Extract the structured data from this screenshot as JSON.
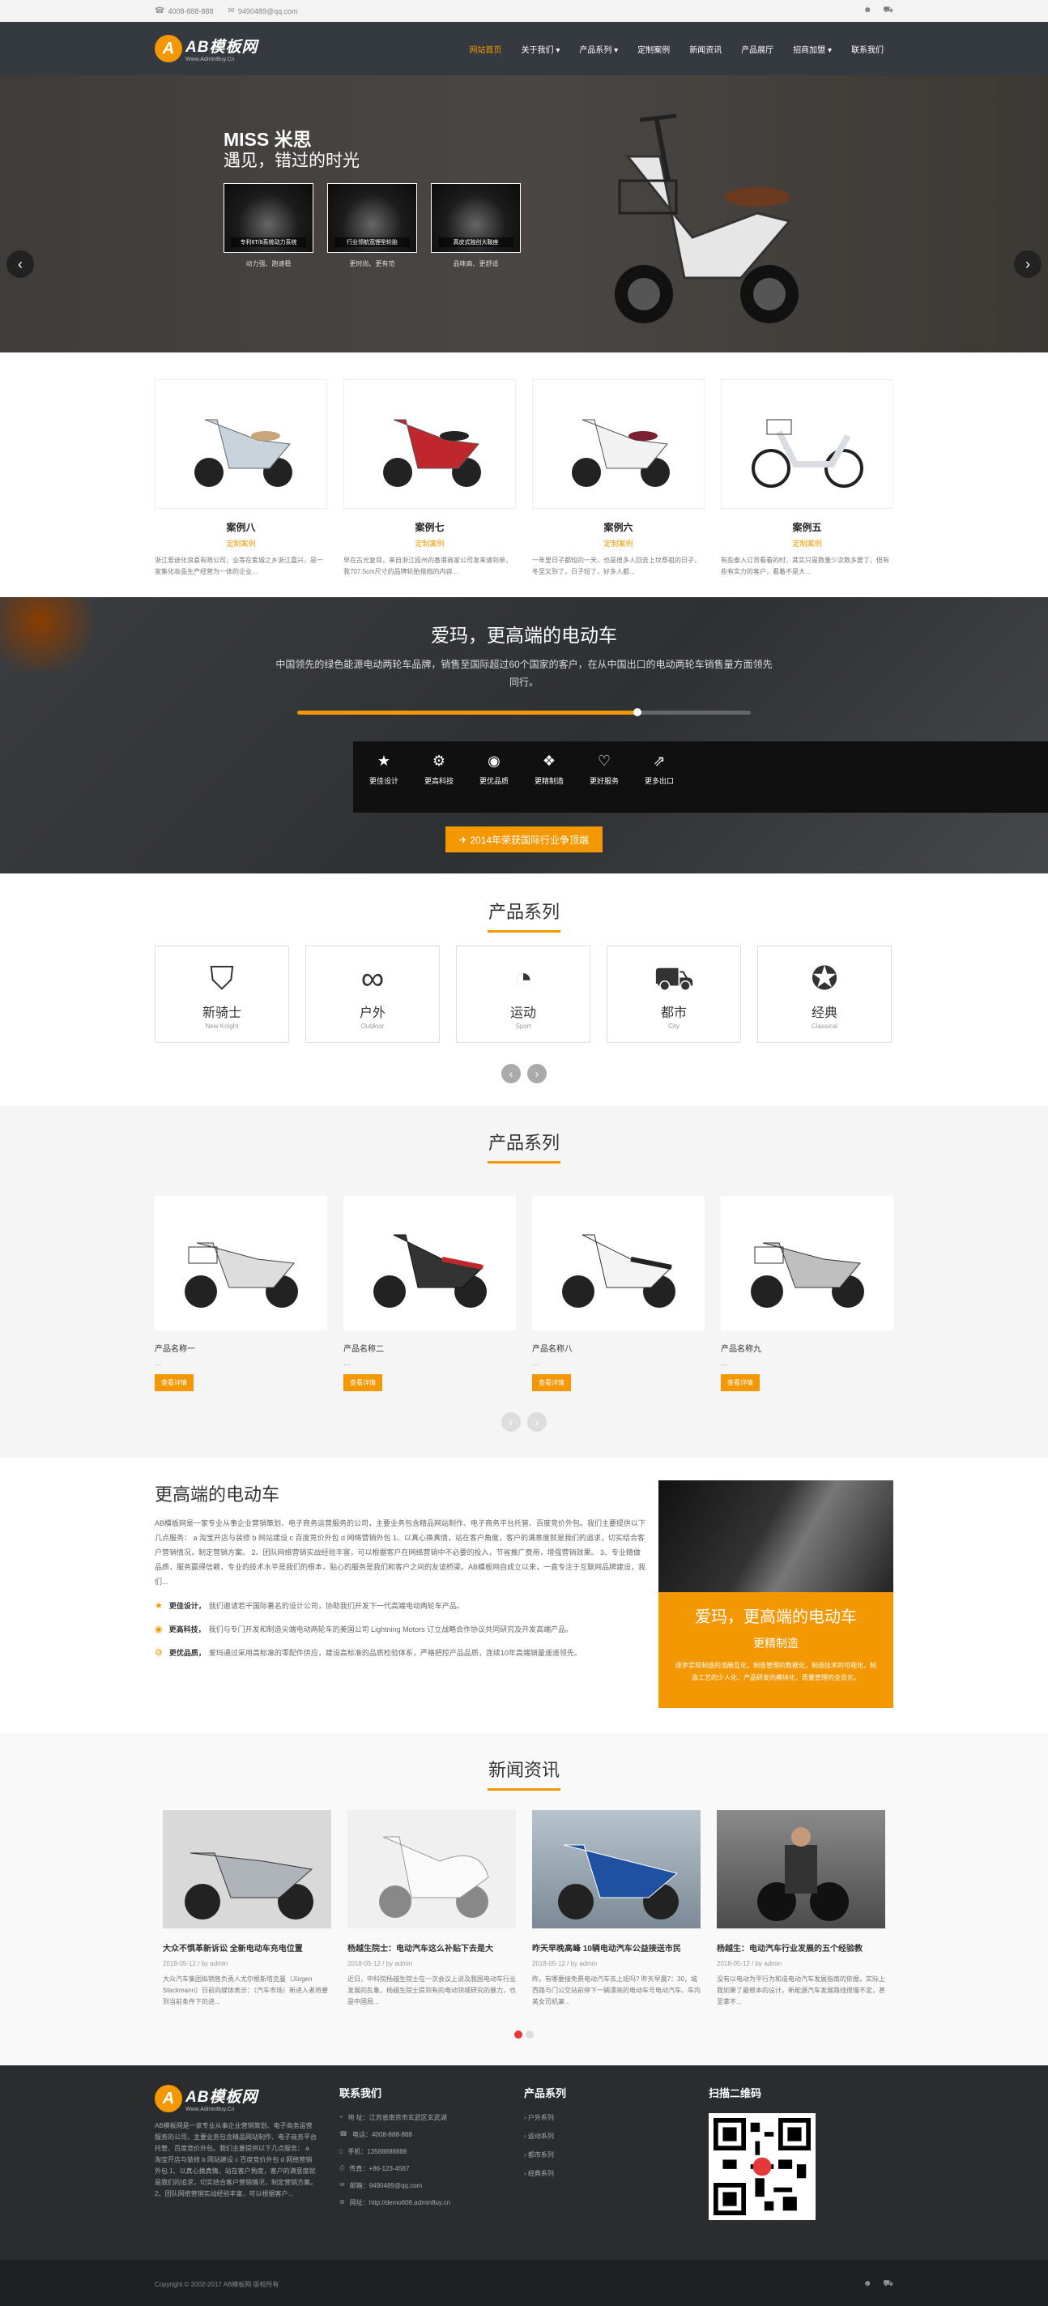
{
  "topbar": {
    "phone": "4008-888-888",
    "email": "9490489@qq.com",
    "user_icon": "user-icon",
    "cart_icon": "cart-icon"
  },
  "header": {
    "logo_name": "AB模板网",
    "logo_sub": "Www.AdminBuy.Cn",
    "nav": [
      "网站首页",
      "关于我们 ▾",
      "产品系列 ▾",
      "定制案例",
      "新闻资讯",
      "产品展厅",
      "招商加盟 ▾",
      "联系我们"
    ]
  },
  "banner": {
    "title": "MISS 米思",
    "subtitle": "遇见，错过的时光",
    "features": [
      {
        "cap": "专利6T/8系统动力系统",
        "desc": "动力强、跑速稳"
      },
      {
        "cap": "行业领航宽锂型轮胎",
        "desc": "更时尚、更有范"
      },
      {
        "cap": "真皮式独创大鞍座",
        "desc": "品味高、更舒适"
      }
    ]
  },
  "cases": [
    {
      "title": "案例八",
      "sub": "定制案例",
      "text": "浙江爱迪化浪喜有限公司，业等在紫城之乡浙江嘉兴，是一家集化妆品生产经营为一体的企业..."
    },
    {
      "title": "案例七",
      "sub": "定制案例",
      "text": "早在古光复目，来自浙江瓯州的香港商家公司发来请到单，我707.5cm尺寸的品牌轮胎搭档的内容..."
    },
    {
      "title": "案例六",
      "sub": "定制案例",
      "text": "一年里日子都短的一天，也是很多人回去上坟祭祖的日子，冬至又到了，日子短了，好多人都..."
    },
    {
      "title": "案例五",
      "sub": "定制案例",
      "text": "有些泰入订货看看的时，其实只是数量少次数多罢了，但有些有实力的客户，看着不是大..."
    }
  ],
  "promo": {
    "title": "爱玛，更高端的电动车",
    "text": "中国领先的绿色能源电动两轮车品牌，销售至国际超过60个国家的客户，在从中国出口的电动两轮车销售量方面领先同行。",
    "progress": 0.75,
    "icons": [
      {
        "label": "更佳设计",
        "icon": "star-icon",
        "glyph": "★"
      },
      {
        "label": "更高科技",
        "icon": "gears-icon",
        "glyph": "⚙"
      },
      {
        "label": "更优品质",
        "icon": "target-icon",
        "glyph": "◉"
      },
      {
        "label": "更精制造",
        "icon": "cubes-icon",
        "glyph": "❖"
      },
      {
        "label": "更好服务",
        "icon": "heart-icon",
        "glyph": "♡"
      },
      {
        "label": "更多出口",
        "icon": "export-icon",
        "glyph": "⇗"
      }
    ],
    "button": "✈ 2014年荣获国际行业争顶端"
  },
  "series": {
    "title": "产品系列",
    "items": [
      {
        "name": "新骑士",
        "en": "New Knight",
        "glyph": "⛉",
        "icon": "helmet-icon"
      },
      {
        "name": "户外",
        "en": "Outdoor",
        "glyph": "∞",
        "icon": "binoculars-icon"
      },
      {
        "name": "运动",
        "en": "Sport",
        "glyph": "◔",
        "icon": "sport-helmet-icon"
      },
      {
        "name": "都市",
        "en": "City",
        "glyph": "⛟",
        "icon": "bus-icon"
      },
      {
        "name": "经典",
        "en": "Classical",
        "glyph": "✪",
        "icon": "medal-icon"
      }
    ]
  },
  "products": {
    "title": "产品系列",
    "items": [
      {
        "name": "产品名称一",
        "dots": "...",
        "btn": "查看详情"
      },
      {
        "name": "产品名称二",
        "dots": "...",
        "btn": "查看详情"
      },
      {
        "name": "产品名称八",
        "dots": "...",
        "btn": "查看详情"
      },
      {
        "name": "产品名称九",
        "dots": "...",
        "btn": "查看详情"
      }
    ]
  },
  "about": {
    "title": "更高端的电动车",
    "text": "AB模板网是一家专业从事企业营销策划、电子商务运营服务的公司，主要业务包含精品网站制作、电子商务平台托管、百度竞价外包。我们主要提供以下几点服务： a 淘宝开店与装修 b 网站建设 c 百度竞价外包 d 网络营销外包 1、以真心换真情，站在客户角度，客户的满意度就是我们的追求，切实结合客户营销情况，制定营销方案。 2、团队网络营销实战经验丰富，可以根据客户在网络营销中不必要的投入，节省推广费用，增强营销效果。 3、专业精做品质，服务赢得信赖，专业的技术水平是我们的根本，贴心的服务是我们和客户之间的友谊桥梁。AB模板网自成立以来，一直专注于互联网品牌建设，我们...",
    "points": [
      {
        "b": "更佳设计，",
        "t": "我们邀请若干国际著名的设计公司，协助我们开发下一代高端电动两轮车产品。"
      },
      {
        "b": "更高科技，",
        "t": "我们与专门开发和制造尖端电动两轮车的美国公司 Lightning Motors 订立战略合作协议共同研究及开发高端产品。"
      },
      {
        "b": "更优品质，",
        "t": "爱玛通过采用高标准的零配件供应，建设高标准的品质检验体系，严格把控产品品质，连续10年高端销量遥遥领先。"
      }
    ],
    "card": {
      "title": "爱玛，更高端的电动车",
      "sub": "更精制造",
      "desc": "逐步实现制造的流融互化，制造管理的数据化，制造技术的可视化，制造工艺的少人化，产品研发的模块化，质量管理的全员化。"
    }
  },
  "news": {
    "title": "新闻资讯",
    "items": [
      {
        "title": "大众不惧革新诉讼 全新电动车充电位置",
        "meta": "2018-05-12 / by admin",
        "text": "大众汽车集团拟销售负责人尤尔根斯塔克曼（Jürgen Stackmann）日前向媒体表示：（汽车市场）新进入者将要到当前条件下的进..."
      },
      {
        "title": "杨越生院士：电动汽车这么补贴下去是大",
        "meta": "2018-05-12 / by admin",
        "text": "近日，中科院杨越生院士在一次会议上谈及我国电动车行业发展的乱象，杨越生院士提到有的电动领域研究的暴力，也是中国局..."
      },
      {
        "title": "昨天早晚高峰 10辆电动汽车公益接送市民",
        "meta": "2018-05-12 / by admin",
        "text": "昨。有哪要接免费电动汽车去上班吗? 昨天早晨7：30，城西路与门公交站前停下一辆漂亮的电动车号电动汽车。车内美女司机兼..."
      },
      {
        "title": "杨越生：电动汽车行业发展的五个经验教",
        "meta": "2018-05-12 / by admin",
        "text": "没有以电动为平行为和造电动汽车发展指南的依据，实际上我如果了最根本的设计。新能源汽车发展路线很慢不定，甚至拿不..."
      }
    ]
  },
  "footer": {
    "logo_name": "AB模板网",
    "logo_sub": "Www.AdminBuy.Cn",
    "about": "AB模板网是一家专业从事企业营销策划、电子商务运营服务的公司，主要业务包含精品网站制作、电子商务平台托管、百度竞价外包。我们主要提供以下几点服务： a 淘宝开店与装修 b 网站建设 c 百度竞价外包 d 网络营销外包 1、以真心换真情，站在客户角度，客户的满意度就是我们的追求，切实结合客户营销情况，制定营销方案。 2、团队网络营销实战经验丰富，可以根据客户...",
    "contact_title": "联系我们",
    "contact": [
      {
        "icon": "location-icon",
        "glyph": "⌖",
        "text": "地 址：江苏省南京市玄武区玄武湖"
      },
      {
        "icon": "phone-icon",
        "glyph": "☎",
        "text": "电话：4008-888-888"
      },
      {
        "icon": "mobile-icon",
        "glyph": "▯",
        "text": "手机：13588888888"
      },
      {
        "icon": "fax-icon",
        "glyph": "⎙",
        "text": "传真：+86-123-4567"
      },
      {
        "icon": "mail-icon",
        "glyph": "✉",
        "text": "邮箱：9490489@qq.com"
      },
      {
        "icon": "globe-icon",
        "glyph": "⊕",
        "text": "网址：http://demo606.admin8uy.cn"
      }
    ],
    "products_title": "产品系列",
    "products": [
      "户外系列",
      "运动系列",
      "都市系列",
      "经典系列"
    ],
    "qr_title": "扫描二维码",
    "copyright": "Copyright © 2002-2017 AB模板网 版权所有"
  }
}
